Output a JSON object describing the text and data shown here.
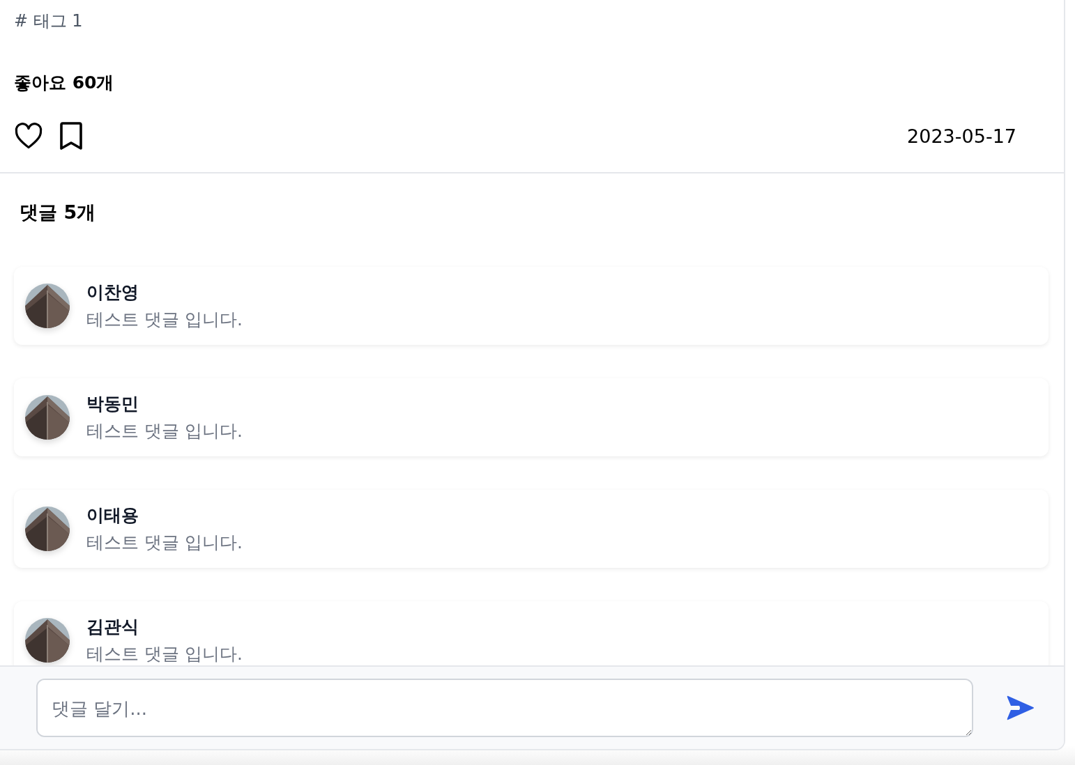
{
  "post": {
    "tag": "# 태그 1",
    "likes": "좋아요 60개",
    "liked": false,
    "bookmarked": false,
    "date": "2023-05-17"
  },
  "comments_heading": "댓글 5개",
  "comments": [
    {
      "author": "이찬영",
      "text": "테스트 댓글 입니다."
    },
    {
      "author": "박동민",
      "text": "테스트 댓글 입니다."
    },
    {
      "author": "이태용",
      "text": "테스트 댓글 입니다."
    },
    {
      "author": "김관식",
      "text": "테스트 댓글 입니다."
    }
  ],
  "comment_input": {
    "placeholder": "댓글 달기..."
  }
}
